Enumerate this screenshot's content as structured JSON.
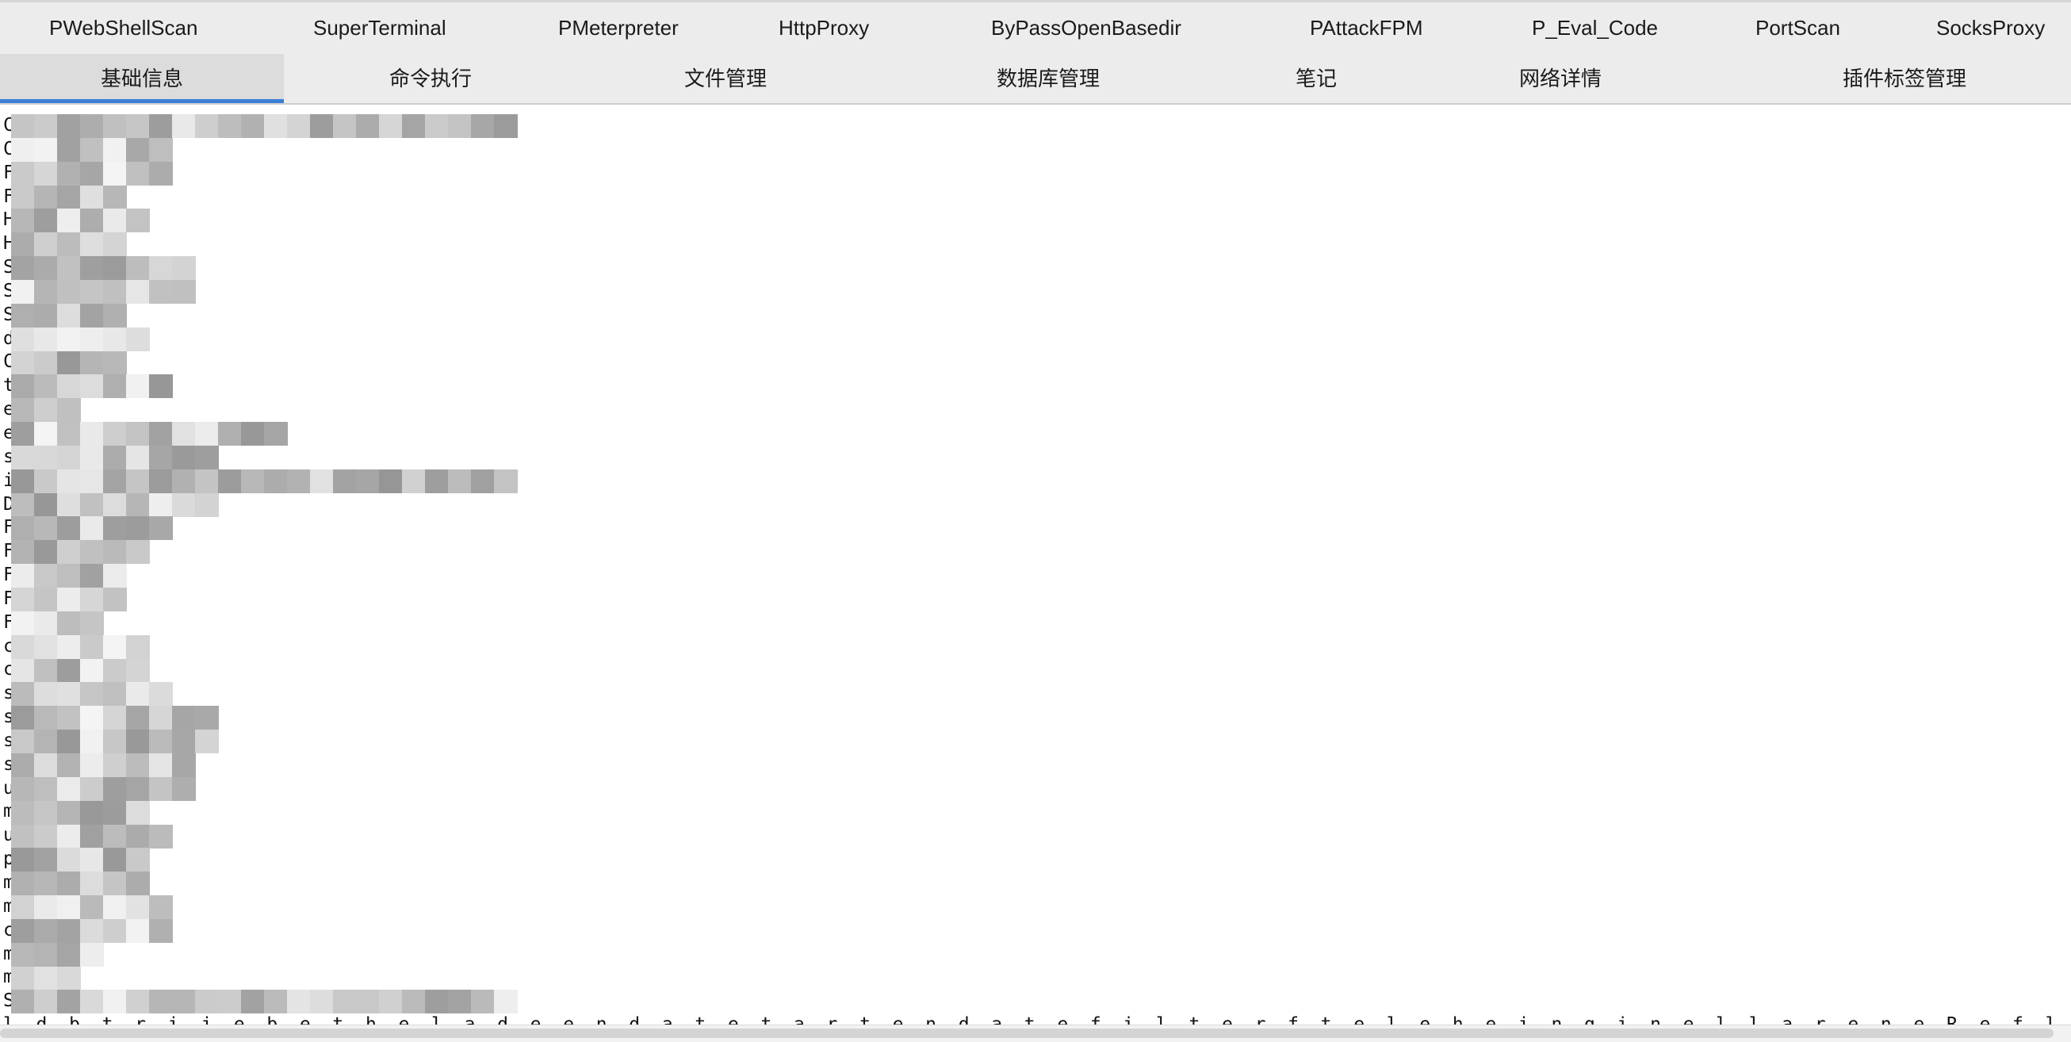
{
  "plugin_tabs": [
    "PWebShellScan",
    "SuperTerminal",
    "PMeterpreter",
    "HttpProxy",
    "ByPassOpenBasedir",
    "PAttackFPM",
    "P_Eval_Code",
    "PortScan",
    "SocksProxy"
  ],
  "main_tabs": [
    "基础信息",
    "命令执行",
    "文件管理",
    "数据库管理",
    "笔记",
    "网络详情",
    "插件标签管理"
  ],
  "active_tab": "基础信息",
  "info_lines": [
    "C                        000",
    "C",
    "F",
    "F",
    "H",
    "H",
    "S",
    "S",
    "S",
    "d",
    "C",
    "t",
    "e",
    "e",
    "s",
    "i                      ebroot\\phplib",
    "D",
    "F",
    "F",
    "F",
    "F",
    "F",
    "c",
    "c",
    "s",
    "s",
    "s",
    "s",
    "u",
    "m",
    "u",
    "p",
    "m",
    "m",
    "c",
    "m",
    "m",
    "S                      5.2.5",
    "l  d  b  t  r  i  j  e  b  e  t  h  e  l  a  d  e  e  n  d  a  t  e  t  a  r  t  e  n  d  a  t  e  f  i  l  t  e  r  f  t  e  l  e  h  e  i  n  g  i  n  e  l  l  a  r  e  n  e  R  e  f  l  e  c  t  i  o  n  e  n  e  i  n  e  l  i  b  e  l  e  c  t  a  h  a  t  e  l  a  h  e  i  n  e  l  i  b  e  S  i  m  p  l  e  X  M  L  e  b  a  e  S  P  L  e  t  h  e  l  a  e  l  a  n  d  e  n  d  e"
  ]
}
